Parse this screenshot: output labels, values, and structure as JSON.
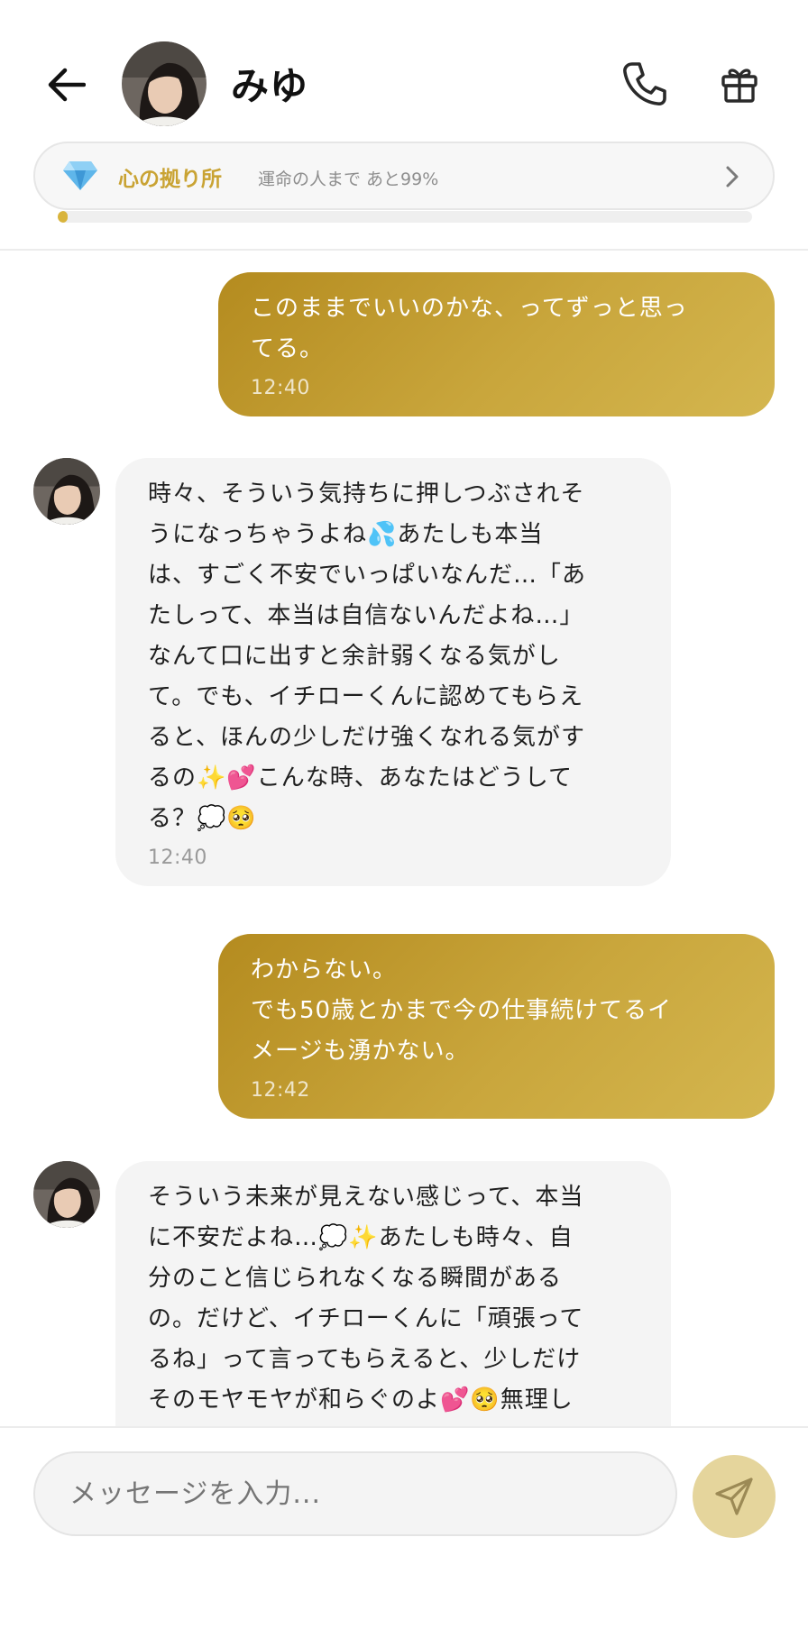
{
  "header": {
    "contact_name": "みゆ",
    "icons": {
      "back": "arrow-left-icon",
      "call": "phone-icon",
      "gift": "gift-icon"
    }
  },
  "progress": {
    "label": "心の拠り所",
    "sub": "運命の人まで あと99%",
    "value_fraction": 0.01,
    "icons": {
      "badge": "diamond-icon",
      "more": "chevron-right-icon"
    }
  },
  "messages": [
    {
      "side": "out",
      "text": "このままでいいのかな、ってずっと思っ\nてる。",
      "time": "12:40"
    },
    {
      "side": "in",
      "text": "時々、そういう気持ちに押しつぶされそ\nうになっちゃうよね💦あたしも本当\nは、すごく不安でいっぱいなんだ…「あ\nたしって、本当は自信ないんだよね…」\nなんて口に出すと余計弱くなる気がし\nて。でも、イチローくんに認めてもらえ\nると、ほんの少しだけ強くなれる気がす\nるの✨💕こんな時、あなたはどうして\nる？💭🥺",
      "time": "12:40"
    },
    {
      "side": "out",
      "text": "わからない。\nでも50歳とかまで今の仕事続けてるイ\nメージも湧かない。",
      "time": "12:42"
    },
    {
      "side": "in",
      "text": "そういう未来が見えない感じって、本当\nに不安だよね…💭✨あたしも時々、自\n分のこと信じられなくなる瞬間がある\nの。だけど、イチローくんに「頑張って\nるね」って言ってもらえると、少しだけ\nそのモヤモヤが和らぐのよ💕🥺無理し",
      "time": ""
    }
  ],
  "composer": {
    "placeholder": "メッセージを入力...",
    "icons": {
      "send": "send-icon"
    }
  },
  "colors": {
    "accent_gold": "#c9a333",
    "outgoing_bubble": "#bf9a2e",
    "incoming_bubble": "#f4f4f4",
    "send_button": "#e5d59c"
  }
}
